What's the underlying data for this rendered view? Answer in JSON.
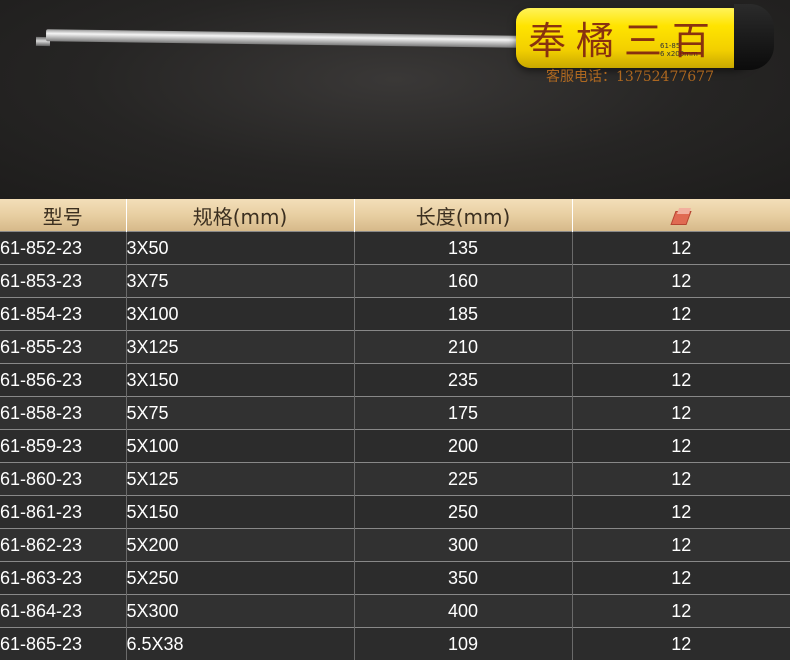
{
  "watermark": {
    "brand": "奉橘三百",
    "contact": "客服电话：13752477677"
  },
  "product_marking": {
    "model": "61-85",
    "size": "6 x200mm"
  },
  "table": {
    "headers": {
      "model": "型号",
      "spec": "规格(mm)",
      "length": "长度(mm)",
      "qty_icon": "box-icon"
    },
    "rows": [
      {
        "model": "61-852-23",
        "spec": "3X50",
        "length": "135",
        "qty": "12"
      },
      {
        "model": "61-853-23",
        "spec": "3X75",
        "length": "160",
        "qty": "12"
      },
      {
        "model": "61-854-23",
        "spec": "3X100",
        "length": "185",
        "qty": "12"
      },
      {
        "model": "61-855-23",
        "spec": "3X125",
        "length": "210",
        "qty": "12"
      },
      {
        "model": "61-856-23",
        "spec": "3X150",
        "length": "235",
        "qty": "12"
      },
      {
        "model": "61-858-23",
        "spec": "5X75",
        "length": "175",
        "qty": "12"
      },
      {
        "model": "61-859-23",
        "spec": "5X100",
        "length": "200",
        "qty": "12"
      },
      {
        "model": "61-860-23",
        "spec": "5X125",
        "length": "225",
        "qty": "12"
      },
      {
        "model": "61-861-23",
        "spec": "5X150",
        "length": "250",
        "qty": "12"
      },
      {
        "model": "61-862-23",
        "spec": "5X200",
        "length": "300",
        "qty": "12"
      },
      {
        "model": "61-863-23",
        "spec": "5X250",
        "length": "350",
        "qty": "12"
      },
      {
        "model": "61-864-23",
        "spec": "5X300",
        "length": "400",
        "qty": "12"
      },
      {
        "model": "61-865-23",
        "spec": "6.5X38",
        "length": "109",
        "qty": "12"
      }
    ]
  }
}
